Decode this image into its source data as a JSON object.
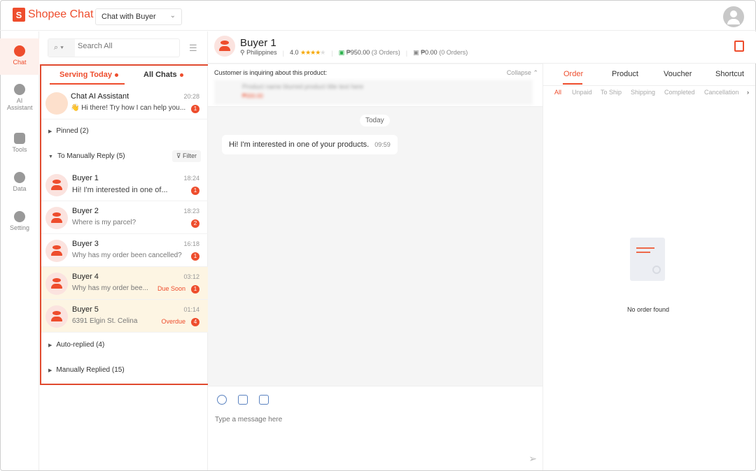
{
  "app": {
    "brand": "Shopee Chat",
    "mode": "Chat with Buyer"
  },
  "nav": [
    {
      "label": "Chat"
    },
    {
      "label": "AI Assistant"
    },
    {
      "label": "Tools"
    },
    {
      "label": "Data"
    },
    {
      "label": "Setting"
    }
  ],
  "search": {
    "placeholder": "Search All"
  },
  "tabs": {
    "serving": "Serving Today",
    "all": "All Chats"
  },
  "ai": {
    "name": "Chat AI Assistant",
    "time": "20:28",
    "msg": "👋 Hi there! Try how I can help you...",
    "badge": "1"
  },
  "sections": {
    "pinned": "Pinned (2)",
    "manual": "To Manually Reply (5)",
    "filter": "Filter",
    "auto": "Auto-replied (4)",
    "replied": "Manually Replied (15)"
  },
  "buyers": [
    {
      "name": "Buyer 1",
      "time": "18:24",
      "msg": "Hi! I'm interested in one of...",
      "badge": "1",
      "tag": ""
    },
    {
      "name": "Buyer 2",
      "time": "18:23",
      "msg": "Where is my parcel?",
      "badge": "2",
      "tag": ""
    },
    {
      "name": "Buyer 3",
      "time": "16:18",
      "msg": "Why has my order been cancelled?",
      "badge": "1",
      "tag": ""
    },
    {
      "name": "Buyer 4",
      "time": "03:12",
      "msg": "Why has my order bee...",
      "badge": "1",
      "tag": "Due Soon"
    },
    {
      "name": "Buyer 5",
      "time": "01:14",
      "msg": "6391 Elgin St. Celina",
      "badge": "4",
      "tag": "Overdue"
    }
  ],
  "chat": {
    "buyer": "Buyer 1",
    "location": "Philippines",
    "rating": "4.0",
    "stars": "★★★★",
    "star_empty": "★",
    "paid": "₱950.00",
    "paid_orders": "(3 Orders)",
    "unpaid": "₱0.00",
    "unpaid_orders": "(0 Orders)",
    "inquiry": "Customer is inquiring about this product:",
    "collapse": "Collapse",
    "product": "Product name blurred product title text here",
    "price": "₱000.00",
    "day": "Today",
    "message": "Hi! I'm interested in one of your products.",
    "message_time": "09:59",
    "placeholder": "Type a message here"
  },
  "right": {
    "tabs": [
      "Order",
      "Product",
      "Voucher",
      "Shortcut"
    ],
    "filters": [
      "All",
      "Unpaid",
      "To Ship",
      "Shipping",
      "Completed",
      "Cancellation"
    ],
    "empty": "No order found"
  },
  "colors": {
    "accent": "#ee4d2d"
  }
}
